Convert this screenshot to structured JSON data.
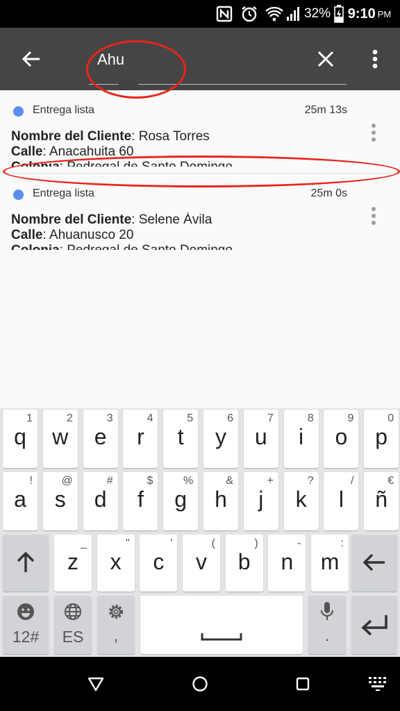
{
  "status_bar": {
    "nfc_icon": "nfc-icon",
    "alarm_icon": "alarm-icon",
    "wifi_icon": "wifi-icon",
    "signal_icon": "signal-icon",
    "battery_percent": "32%",
    "battery_icon": "battery-charging-icon",
    "time": "9:10",
    "ampm": "PM"
  },
  "toolbar": {
    "back_icon": "arrow-back-icon",
    "search_value": "Ahu",
    "clear_icon": "close-icon",
    "more_icon": "more-vert-icon",
    "background": "#454545"
  },
  "list": {
    "items": [
      {
        "status_label": "Entrega lista",
        "status_color": "#5b8ef0",
        "elapsed": "25m 13s",
        "client_label": "Nombre del Cliente",
        "client_value": ": Rosa Torres",
        "street_label": "Calle",
        "street_value": ": Anacahuita 60",
        "colonia_label": "Colonia",
        "colonia_value": ": Pedregal de Santo Domingo"
      },
      {
        "status_label": "Entrega lista",
        "status_color": "#5b8ef0",
        "elapsed": "25m 0s",
        "client_label": "Nombre del Cliente",
        "client_value": ": Selene Ávila",
        "street_label": "Calle",
        "street_value": ": Ahuanusco 20",
        "colonia_label": "Colonia",
        "colonia_value": ": Pedregal de Santo Domingo"
      }
    ]
  },
  "keyboard": {
    "row1": [
      {
        "key": "q",
        "hint": "1"
      },
      {
        "key": "w",
        "hint": "2"
      },
      {
        "key": "e",
        "hint": "3"
      },
      {
        "key": "r",
        "hint": "4"
      },
      {
        "key": "t",
        "hint": "5"
      },
      {
        "key": "y",
        "hint": "6"
      },
      {
        "key": "u",
        "hint": "7"
      },
      {
        "key": "i",
        "hint": "8"
      },
      {
        "key": "o",
        "hint": "9"
      },
      {
        "key": "p",
        "hint": "0"
      }
    ],
    "row2": [
      {
        "key": "a",
        "hint": "!"
      },
      {
        "key": "s",
        "hint": "@"
      },
      {
        "key": "d",
        "hint": "#"
      },
      {
        "key": "f",
        "hint": "$"
      },
      {
        "key": "g",
        "hint": "%"
      },
      {
        "key": "h",
        "hint": "&"
      },
      {
        "key": "j",
        "hint": "+"
      },
      {
        "key": "k",
        "hint": "?"
      },
      {
        "key": "l",
        "hint": "/"
      },
      {
        "key": "ñ",
        "hint": "€"
      }
    ],
    "row3": [
      {
        "key": "z",
        "hint": "_"
      },
      {
        "key": "x",
        "hint": "\""
      },
      {
        "key": "c",
        "hint": "'"
      },
      {
        "key": "v",
        "hint": "("
      },
      {
        "key": "b",
        "hint": ")"
      },
      {
        "key": "n",
        "hint": "-"
      },
      {
        "key": "m",
        "hint": ":"
      }
    ],
    "shift_icon": "shift-arrow-up-icon",
    "backspace_icon": "backspace-arrow-icon",
    "symbols_label": "12#",
    "emoji_icon": "emoji-icon",
    "language_label": "ES",
    "globe_icon": "globe-icon",
    "settings_icon": "gear-icon",
    "comma_label": ",",
    "space_icon": "space-bar-icon",
    "mic_icon": "microphone-icon",
    "period_label": ".",
    "enter_icon": "enter-return-icon"
  },
  "nav_bar": {
    "back_icon": "nav-back-triangle-icon",
    "home_icon": "nav-home-circle-icon",
    "recents_icon": "nav-recents-square-icon",
    "keyboard_icon": "keyboard-hide-icon"
  },
  "annotation_color": "#e8251b"
}
